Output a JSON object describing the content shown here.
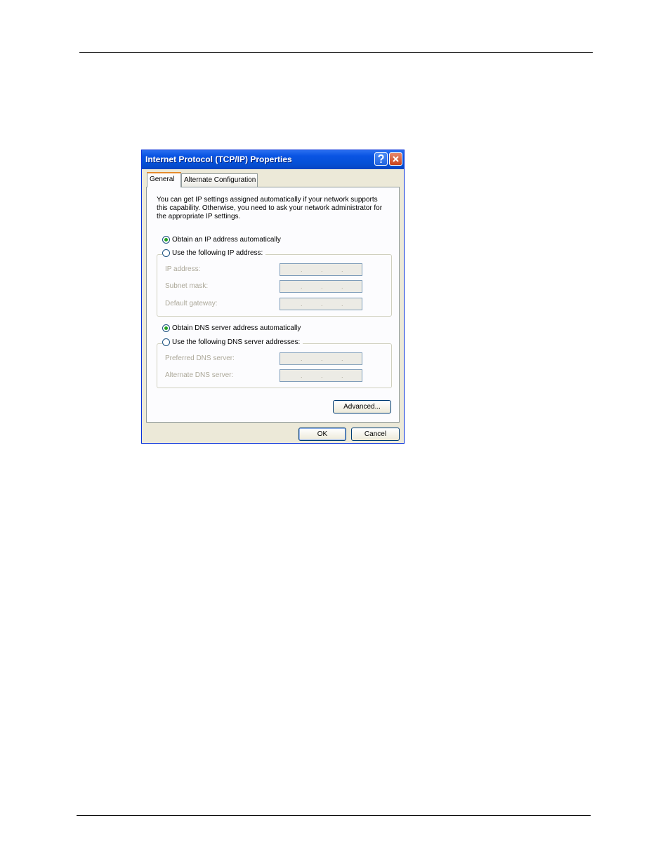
{
  "dialog": {
    "title": "Internet Protocol (TCP/IP) Properties",
    "help_icon": "question-mark-icon",
    "close_icon": "close-icon",
    "tabs": [
      {
        "label": "General",
        "selected": true
      },
      {
        "label": "Alternate Configuration",
        "selected": false
      }
    ],
    "description": "You can get IP settings assigned automatically if your network supports this capability. Otherwise, you need to ask your network administrator for the appropriate IP settings.",
    "ip_options": {
      "auto_label": "Obtain an IP address automatically",
      "manual_label": "Use the following IP address:",
      "selected": "auto"
    },
    "ip_fields": {
      "ip_address_label": "IP address:",
      "subnet_mask_label": "Subnet mask:",
      "default_gateway_label": "Default gateway:"
    },
    "dns_options": {
      "auto_label": "Obtain DNS server address automatically",
      "manual_label": "Use the following DNS server addresses:",
      "selected": "auto"
    },
    "dns_fields": {
      "preferred_label": "Preferred DNS server:",
      "alternate_label": "Alternate DNS server:"
    },
    "ip_dot": ".",
    "buttons": {
      "advanced": "Advanced...",
      "ok": "OK",
      "cancel": "Cancel"
    },
    "colors": {
      "titlebar": "#0550d6",
      "face": "#ece9d8",
      "selected_radio": "#21a121",
      "disabled_text": "#aca899"
    }
  }
}
